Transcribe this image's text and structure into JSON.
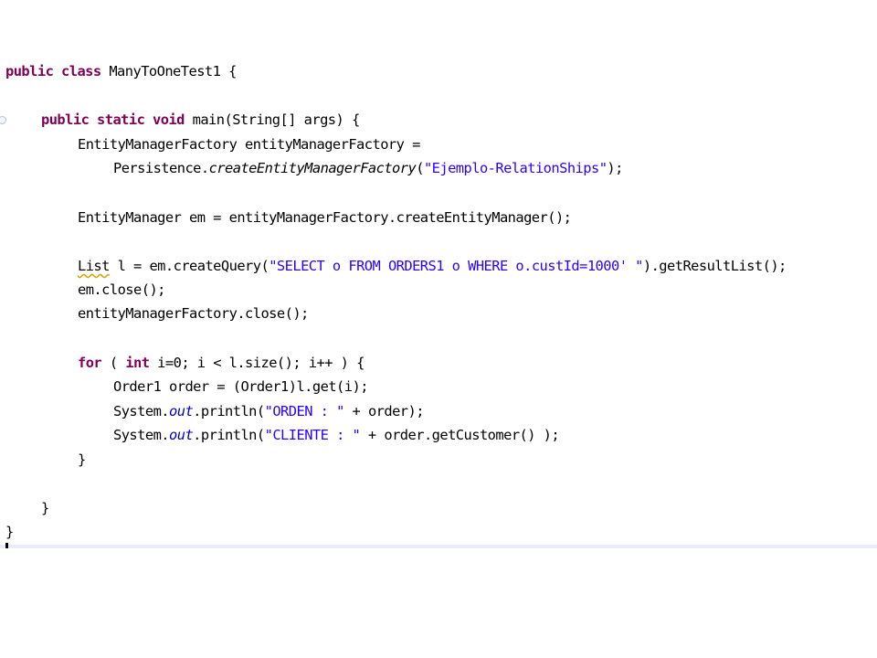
{
  "code": {
    "l1": {
      "kw1": "public",
      "kw2": "class",
      "name": "ManyToOneTest1 {"
    },
    "l2": {
      "kw1": "public",
      "kw2": "static",
      "kw3": "void",
      "rest": "main(String[] args) {"
    },
    "l3": {
      "text": "EntityManagerFactory entityManagerFactory ="
    },
    "l4": {
      "pre": "Persistence.",
      "method": "createEntityManagerFactory",
      "open": "(",
      "str": "\"Ejemplo-RelationShips\"",
      "close": ");"
    },
    "l5": {
      "text": "EntityManager em = entityManagerFactory.createEntityManager();"
    },
    "l6": {
      "warn": "List",
      "pre": " l = em.createQuery(",
      "str": "\"SELECT o FROM ORDERS1 o WHERE o.custId=1000' \"",
      "post": ").getResultList();"
    },
    "l7": {
      "text": "em.close();"
    },
    "l8": {
      "text": "entityManagerFactory.close();"
    },
    "l9": {
      "kw1": "for",
      "mid": " ( ",
      "kw2": "int",
      "rest": " i=0; i < l.size(); i++ ) {"
    },
    "l10": {
      "text": "Order1 order = (Order1)l.get(i);"
    },
    "l11": {
      "pre": "System.",
      "field": "out",
      "mid": ".println(",
      "str": "\"ORDEN : \"",
      "post": " + order);"
    },
    "l12": {
      "pre": "System.",
      "field": "out",
      "mid": ".println(",
      "str": "\"CLIENTE : \"",
      "post": " + order.getCustomer() );"
    },
    "l13": {
      "text": "}"
    },
    "l14": {
      "text": "}"
    },
    "l15": {
      "text": "}"
    }
  }
}
